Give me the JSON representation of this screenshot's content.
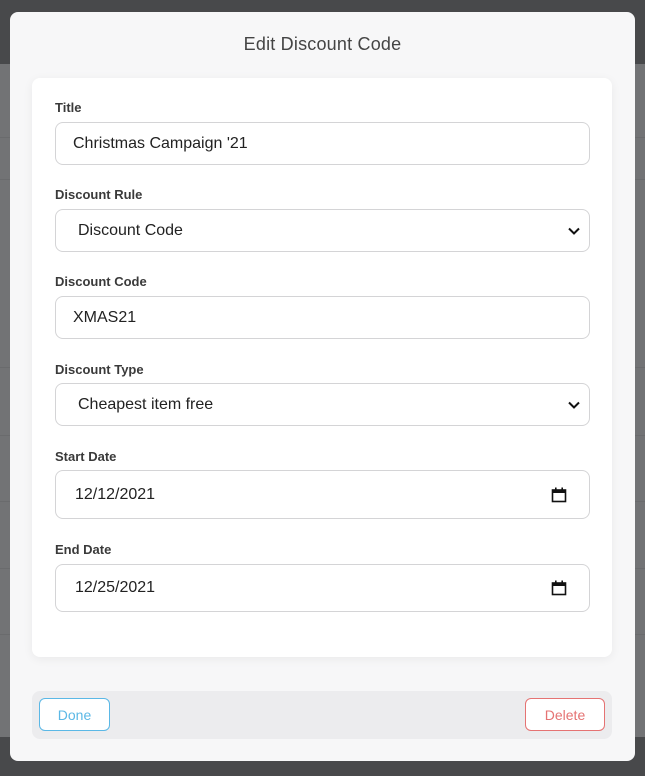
{
  "modal": {
    "title": "Edit Discount Code",
    "fields": {
      "title": {
        "label": "Title",
        "value": "Christmas Campaign '21"
      },
      "discount_rule": {
        "label": "Discount Rule",
        "value": "Discount Code",
        "icon": "chevron-down-icon"
      },
      "discount_code": {
        "label": "Discount Code",
        "value": "XMAS21"
      },
      "discount_type": {
        "label": "Discount Type",
        "value": "Cheapest item free",
        "icon": "chevron-down-icon"
      },
      "start_date": {
        "label": "Start Date",
        "value": "12/12/2021",
        "icon": "calendar-icon"
      },
      "end_date": {
        "label": "End Date",
        "value": "12/25/2021",
        "icon": "calendar-icon"
      }
    },
    "footer": {
      "done_label": "Done",
      "delete_label": "Delete"
    }
  },
  "colors": {
    "done": "#5bb8e6",
    "delete": "#e57373",
    "overlay": "#727375"
  }
}
